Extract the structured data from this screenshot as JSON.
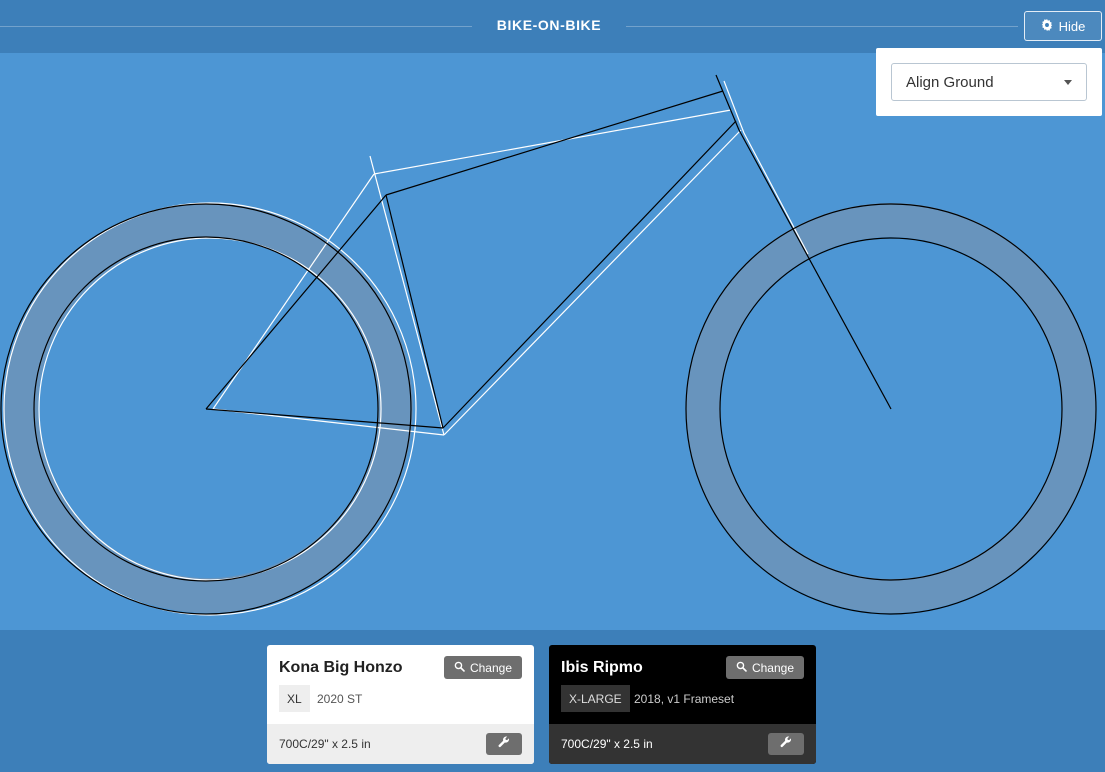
{
  "header": {
    "title": "BIKE-ON-BIKE",
    "hide_label": "Hide"
  },
  "align": {
    "selected": "Align Ground"
  },
  "bikes": [
    {
      "name": "Kona Big Honzo",
      "size": "XL",
      "year": "2020 ST",
      "tire": "700C/29\" x 2.5 in",
      "change_label": "Change",
      "theme": "light"
    },
    {
      "name": "Ibis Ripmo",
      "size": "X-LARGE",
      "year": "2018, v1 Frameset",
      "tire": "700C/29\" x 2.5 in",
      "change_label": "Change",
      "theme": "dark"
    }
  ],
  "colors": {
    "background": "#4d96d4",
    "header": "#3d7fb9",
    "tire_fill": "#6894bd",
    "bike_a_stroke": "#ffffff",
    "bike_b_stroke": "#000000",
    "button": "#6e6e6e"
  },
  "icons": {
    "hide": "gear-icon",
    "change": "search-icon",
    "settings": "wrench-icon",
    "dropdown": "caret-down-icon"
  }
}
